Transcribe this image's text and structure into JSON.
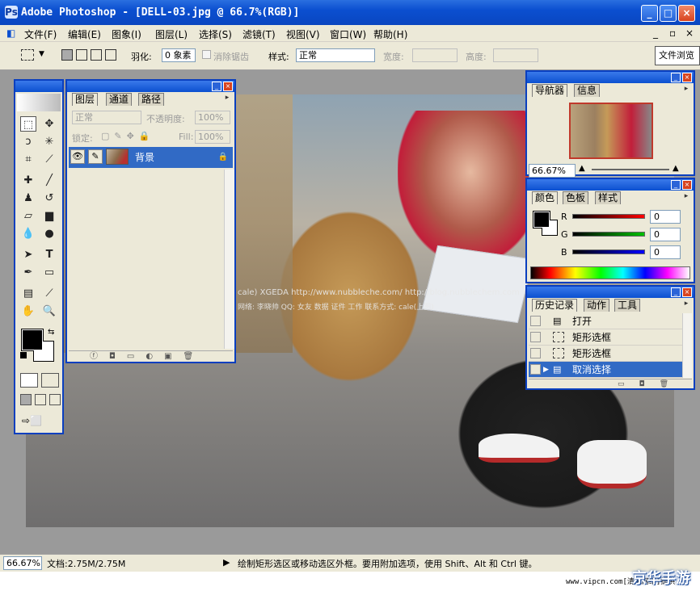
{
  "window": {
    "title": "Adobe Photoshop - [DELL-03.jpg @ 66.7%(RGB)]",
    "controls": [
      "_",
      "□",
      "×"
    ]
  },
  "menubar": {
    "items": [
      "文件(F)",
      "编辑(E)",
      "图象(I)",
      "图层(L)",
      "选择(S)",
      "滤镜(T)",
      "视图(V)",
      "窗口(W)",
      "帮助(H)"
    ],
    "doc_controls": [
      "_",
      "▫",
      "×"
    ]
  },
  "options": {
    "feather_label": "羽化:",
    "feather_value": "0 象素",
    "antialias_label": "消除锯齿",
    "style_label": "样式:",
    "style_value": "正常",
    "width_label": "宽度:",
    "height_label": "高度:",
    "file_browser": "文件浏览"
  },
  "canvas": {
    "watermark_line1": "cale) XGEDA    http://www.nubbleche.com/   http://blog.nubblechem.com",
    "watermark_line2": "网络: 李晓帅   QQ: 女友   数据   证件   工作   联系方式: cale(上图)"
  },
  "layers": {
    "tabs": [
      "图层",
      "通道",
      "路径"
    ],
    "blend_mode": "正常",
    "opacity_label": "不透明度:",
    "opacity_value": "100%",
    "lock_label": "锁定:",
    "fill_label": "Fill:",
    "fill_value": "100%",
    "layer_name": "背景"
  },
  "navigator": {
    "tabs": [
      "导航器",
      "信息"
    ],
    "zoom": "66.67%"
  },
  "color": {
    "tabs": [
      "颜色",
      "色板",
      "样式"
    ],
    "r_label": "R",
    "r_value": "0",
    "g_label": "G",
    "g_value": "0",
    "b_label": "B",
    "b_value": "0"
  },
  "history": {
    "tabs": [
      "历史记录",
      "动作",
      "工具"
    ],
    "items": [
      "打开",
      "矩形选框",
      "矩形选框",
      "取消选择"
    ]
  },
  "status": {
    "zoom": "66.67%",
    "doc_info": "文档:2.75M/2.75M",
    "hint": "绘制矩形选区或移动选区外框。要用附加选项，使用 Shift、Alt 和 Ctrl 键。"
  },
  "footer": {
    "site": "www.vipcn.com[清风网络]提供",
    "brand": "京华手游"
  },
  "colors": {
    "title_blue": "#0b4fd0",
    "panel_bg": "#ece9d8",
    "selection": "#316ac5"
  }
}
